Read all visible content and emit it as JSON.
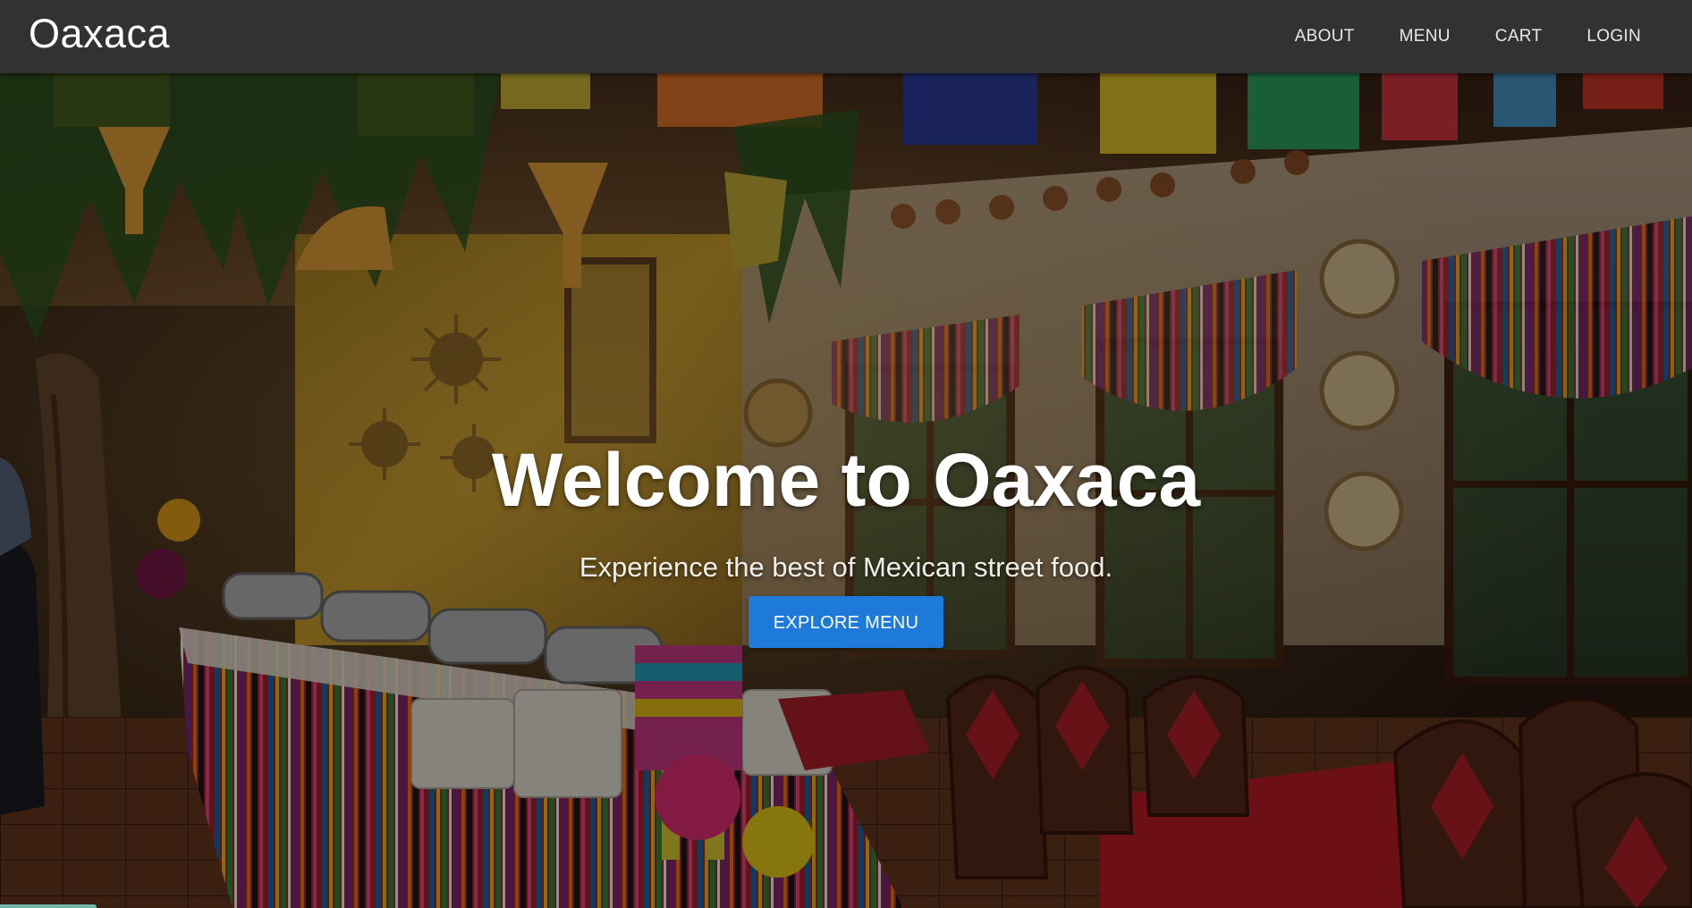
{
  "navbar": {
    "brand": "Oaxaca",
    "links": [
      "ABOUT",
      "MENU",
      "CART",
      "LOGIN"
    ]
  },
  "hero": {
    "title": "Welcome to Oaxaca",
    "subtitle": "Experience the best of Mexican street food.",
    "button_label": "EXPLORE MENU"
  },
  "colors": {
    "navbar_bg": "#323232",
    "button_bg": "#1e7ad8",
    "text": "#ffffff"
  }
}
